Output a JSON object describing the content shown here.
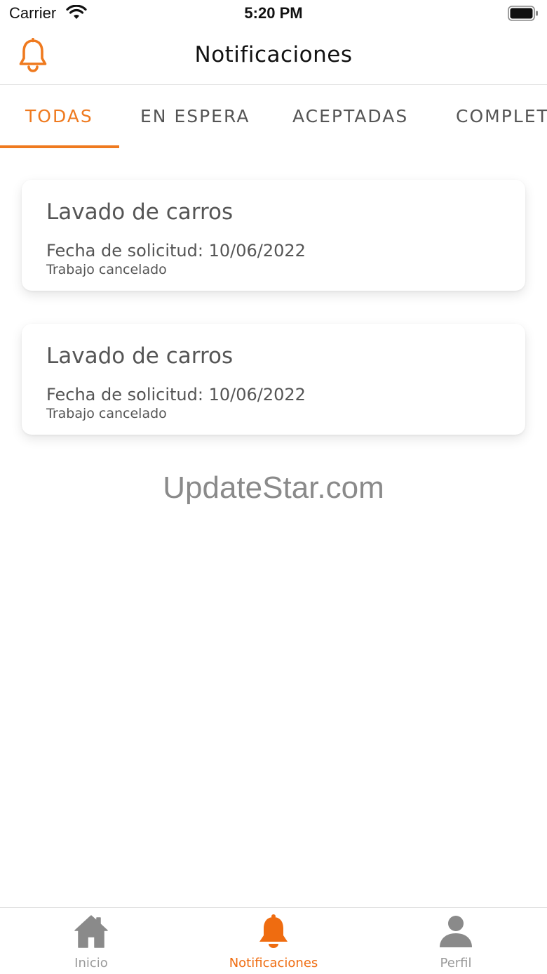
{
  "status_bar": {
    "carrier": "Carrier",
    "time": "5:20 PM"
  },
  "header": {
    "title": "Notificaciones",
    "icon": "bell-outline-icon"
  },
  "tabs": [
    {
      "label": "TODAS",
      "active": true
    },
    {
      "label": "EN ESPERA",
      "active": false
    },
    {
      "label": "ACEPTADAS",
      "active": false
    },
    {
      "label": "COMPLETADAS",
      "active": false
    }
  ],
  "notifications": [
    {
      "title": "Lavado de carros",
      "date_line": "Fecha de solicitud: 10/06/2022",
      "status": "Trabajo cancelado"
    },
    {
      "title": "Lavado de carros",
      "date_line": "Fecha de solicitud: 10/06/2022",
      "status": "Trabajo cancelado"
    }
  ],
  "watermark": "UpdateStar.com",
  "tabbar": {
    "items": [
      {
        "label": "Inicio",
        "icon": "home-icon",
        "active": false
      },
      {
        "label": "Notificaciones",
        "icon": "bell-icon",
        "active": true
      },
      {
        "label": "Perfil",
        "icon": "user-icon",
        "active": false
      }
    ]
  },
  "colors": {
    "accent": "#ef7a1f",
    "inactive_icon": "#8a8a8a",
    "text": "#555555"
  }
}
